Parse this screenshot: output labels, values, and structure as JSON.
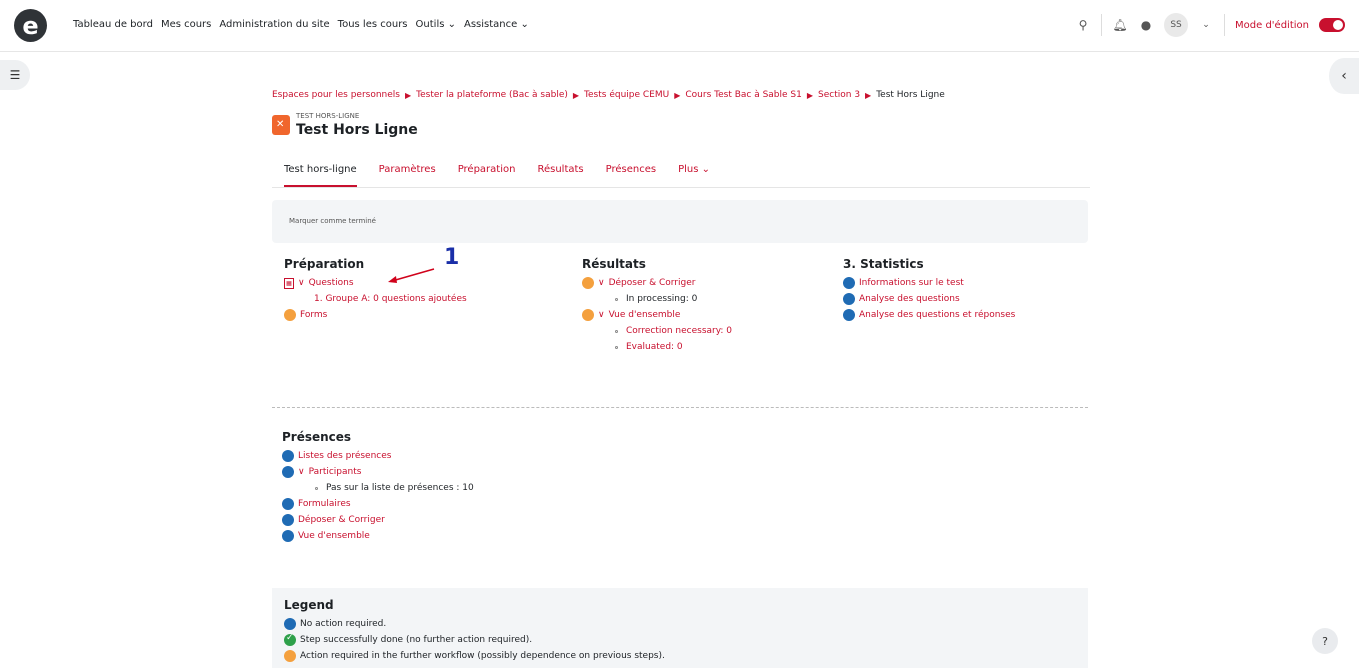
{
  "nav": {
    "logo": "e",
    "links": [
      "Tableau de bord",
      "Mes cours",
      "Administration du site",
      "Tous les cours",
      "Outils ⌄",
      "Assistance ⌄"
    ],
    "avatar": "SS",
    "edit_mode_label": "Mode d'édition"
  },
  "breadcrumb": [
    "Espaces pour les personnels",
    "Tester la plateforme (Bac à sable)",
    "Tests équipe CEMU",
    "Cours Test Bac à Sable S1",
    "Section 3"
  ],
  "breadcrumb_current": "Test Hors Ligne",
  "header": {
    "pretitle": "TEST HORS-LIGNE",
    "title": "Test Hors Ligne"
  },
  "tabs": [
    "Test hors-ligne",
    "Paramètres",
    "Préparation",
    "Résultats",
    "Présences",
    "Plus ⌄"
  ],
  "completion": "Marquer comme terminé",
  "preparation": {
    "title": "Préparation",
    "questions": "Questions",
    "questions_sub": "1. Groupe A: 0 questions ajoutées",
    "forms": "Forms"
  },
  "annotation": "1",
  "resultats": {
    "title": "Résultats",
    "deposer": "Déposer & Corriger",
    "deposer_sub": "In processing: 0",
    "vue": "Vue d'ensemble",
    "vue_sub1": "Correction necessary: 0",
    "vue_sub2": "Evaluated: 0"
  },
  "statistics": {
    "title": "3. Statistics",
    "items": [
      "Informations sur le test",
      "Analyse des questions",
      "Analyse des questions et réponses"
    ]
  },
  "presences": {
    "title": "Présences",
    "listes": "Listes des présences",
    "participants": "Participants",
    "participants_sub": "Pas sur la liste de présences : 10",
    "formulaires": "Formulaires",
    "deposer": "Déposer & Corriger",
    "vue": "Vue d'ensemble"
  },
  "legend": {
    "title": "Legend",
    "items": [
      "No action required.",
      "Step successfully done (no further action required).",
      "Action required in the further workflow (possibly dependence on previous steps)."
    ]
  },
  "help": "?"
}
